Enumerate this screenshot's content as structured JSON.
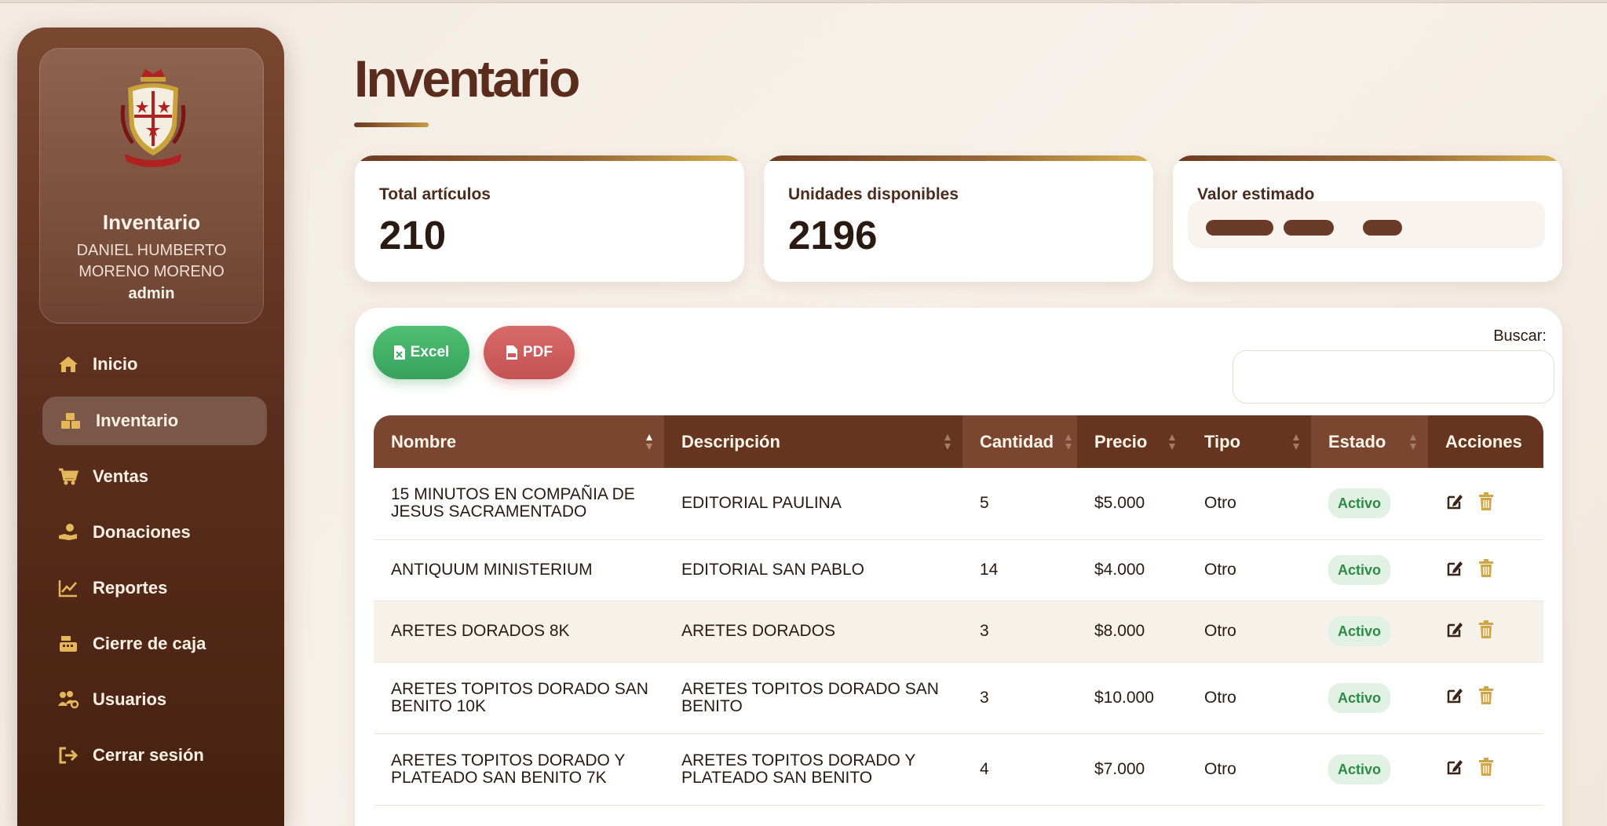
{
  "sidebar": {
    "profile": {
      "title": "Inventario",
      "name_line1": "DANIEL HUMBERTO",
      "name_line2": "MORENO MORENO",
      "role": "admin"
    },
    "items": [
      {
        "label": "Inicio",
        "icon": "home-icon"
      },
      {
        "label": "Inventario",
        "icon": "boxes-icon",
        "active": true
      },
      {
        "label": "Ventas",
        "icon": "cart-icon"
      },
      {
        "label": "Donaciones",
        "icon": "donation-hand-icon"
      },
      {
        "label": "Reportes",
        "icon": "chart-line-icon"
      },
      {
        "label": "Cierre de caja",
        "icon": "cash-register-icon"
      },
      {
        "label": "Usuarios",
        "icon": "users-gear-icon"
      },
      {
        "label": "Cerrar sesión",
        "icon": "logout-icon"
      }
    ]
  },
  "main": {
    "title": "Inventario",
    "stats": [
      {
        "label": "Total artículos",
        "value": "210"
      },
      {
        "label": "Unidades disponibles",
        "value": "2196"
      },
      {
        "label": "Valor estimado",
        "value": ""
      }
    ],
    "toolbar": {
      "excel_label": "Excel",
      "pdf_label": "PDF",
      "search_label": "Buscar:",
      "search_value": ""
    },
    "table": {
      "columns": [
        "Nombre",
        "Descripción",
        "Cantidad",
        "Precio",
        "Tipo",
        "Estado",
        "Acciones"
      ],
      "rows": [
        {
          "nombre": "15 MINUTOS EN COMPAÑIA DE JESUS SACRAMENTADO",
          "descripcion": "EDITORIAL PAULINA",
          "cantidad": "5",
          "precio": "$5.000",
          "tipo": "Otro",
          "estado": "Activo"
        },
        {
          "nombre": "ANTIQUUM MINISTERIUM",
          "descripcion": "EDITORIAL SAN PABLO",
          "cantidad": "14",
          "precio": "$4.000",
          "tipo": "Otro",
          "estado": "Activo"
        },
        {
          "nombre": "ARETES DORADOS 8K",
          "descripcion": "ARETES DORADOS",
          "cantidad": "3",
          "precio": "$8.000",
          "tipo": "Otro",
          "estado": "Activo"
        },
        {
          "nombre": "ARETES TOPITOS DORADO SAN BENITO 10K",
          "descripcion": "ARETES TOPITOS DORADO SAN BENITO",
          "cantidad": "3",
          "precio": "$10.000",
          "tipo": "Otro",
          "estado": "Activo"
        },
        {
          "nombre": "ARETES TOPITOS DORADO Y PLATEADO SAN BENITO 7K",
          "descripcion": "ARETES TOPITOS DORADO Y PLATEADO SAN BENITO",
          "cantidad": "4",
          "precio": "$7.000",
          "tipo": "Otro",
          "estado": "Activo"
        }
      ]
    }
  },
  "colors": {
    "sidebar_top": "#7a4730",
    "sidebar_bottom": "#45210f",
    "table_header": "#65351f",
    "accent_gold": "#d6b250",
    "excel_green": "#3fae66",
    "pdf_red": "#cf5c5c",
    "badge_green": "#2e8a44"
  }
}
